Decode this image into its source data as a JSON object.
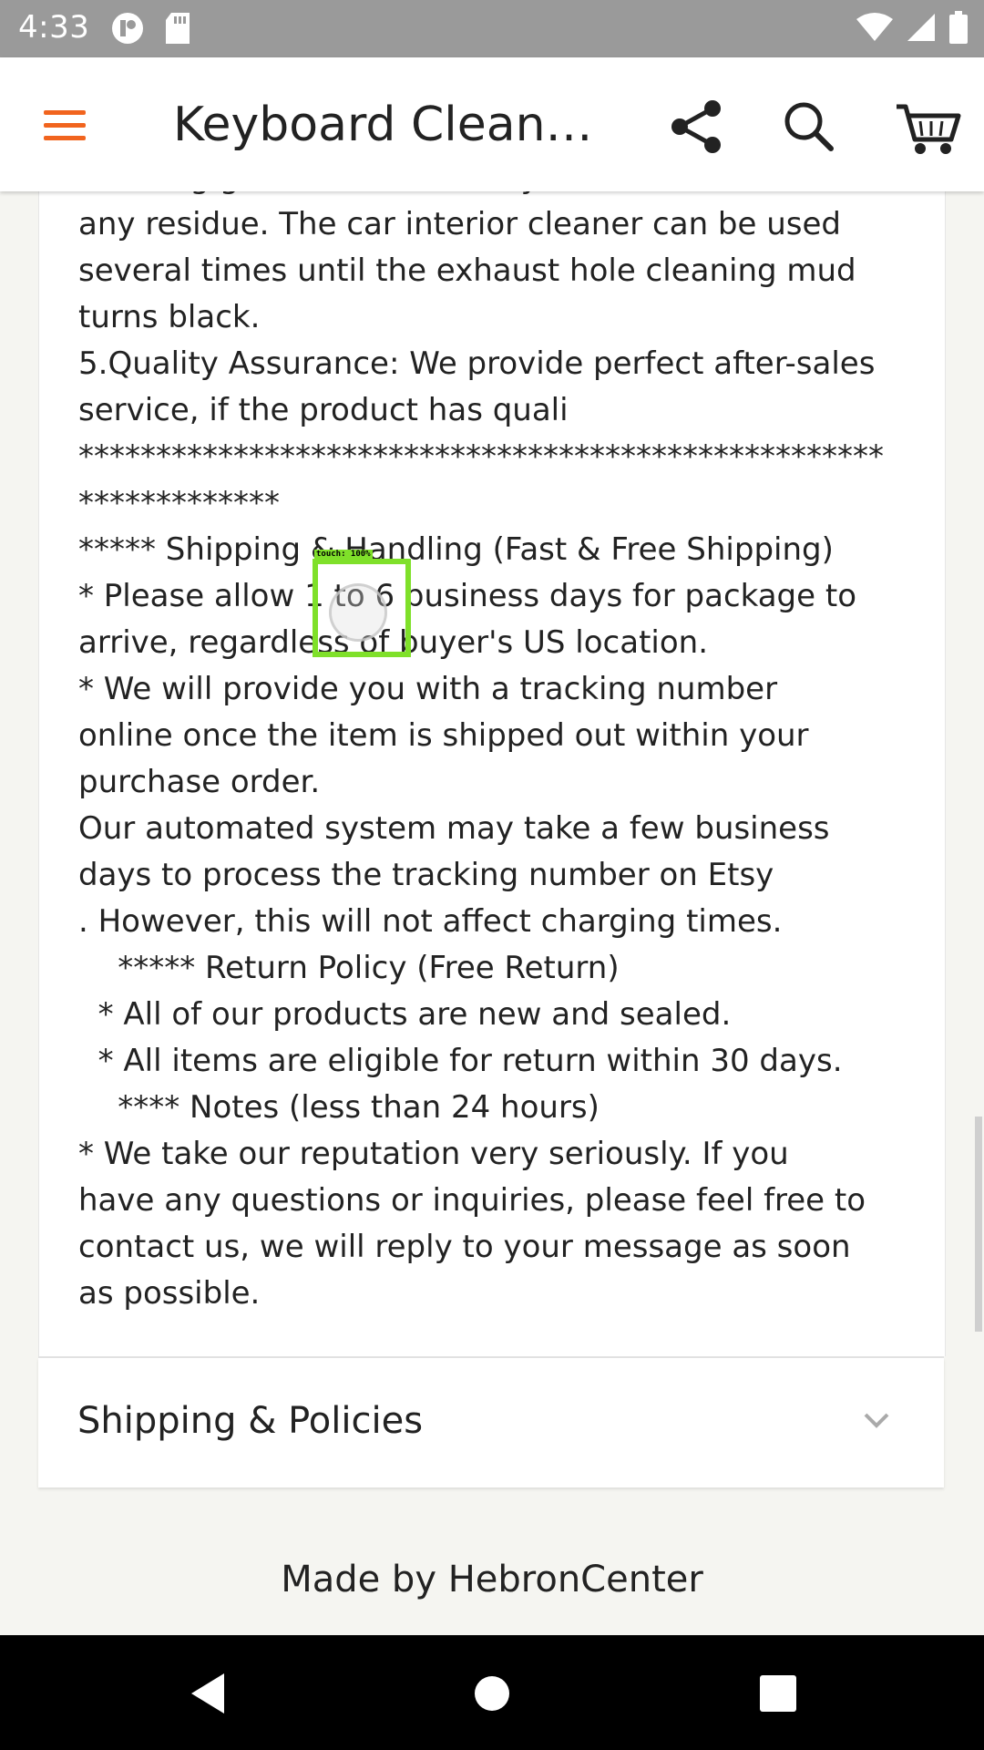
{
  "status_bar": {
    "time": "4:33"
  },
  "app_bar": {
    "title": "Keyboard Cleane…"
  },
  "description": {
    "lines": [
      "cleaning gel will not stick to your hands or leave",
      "any residue. The car interior cleaner can be used",
      "several times until the exhaust hole cleaning mud",
      "turns black.",
      "5.Quality Assurance: We provide perfect after-sales",
      "service, if the product has quali",
      "****************************************************",
      "*************",
      "***** Shipping & Handling (Fast & Free Shipping)",
      "* Please allow 1 to 6 business days for package to",
      "arrive, regardless of buyer's US location.",
      "* We will provide you with a tracking number",
      "online once the item is shipped out within your",
      "purchase order.",
      "Our automated system may take a few business",
      "days to process the tracking number on Etsy",
      ". However, this will not affect charging times.",
      "    ***** Return Policy (Free Return)",
      "  * All of our products are new and sealed.",
      "  * All items are eligible for return within 30 days.",
      "    **** Notes (less than 24 hours)",
      "* We take our reputation very seriously. If you",
      "have any questions or inquiries, please feel free to",
      "contact us, we will reply to your message as soon",
      "as possible."
    ]
  },
  "shipping_section": {
    "label": "Shipping & Policies"
  },
  "footer": {
    "made_by": "Made by HebronCenter"
  },
  "touch_indicator": {
    "label": "touch: 100%"
  },
  "colors": {
    "accent": "#f1641e",
    "status_bar": "#9a9a9a",
    "touch": "#7fe02a"
  }
}
